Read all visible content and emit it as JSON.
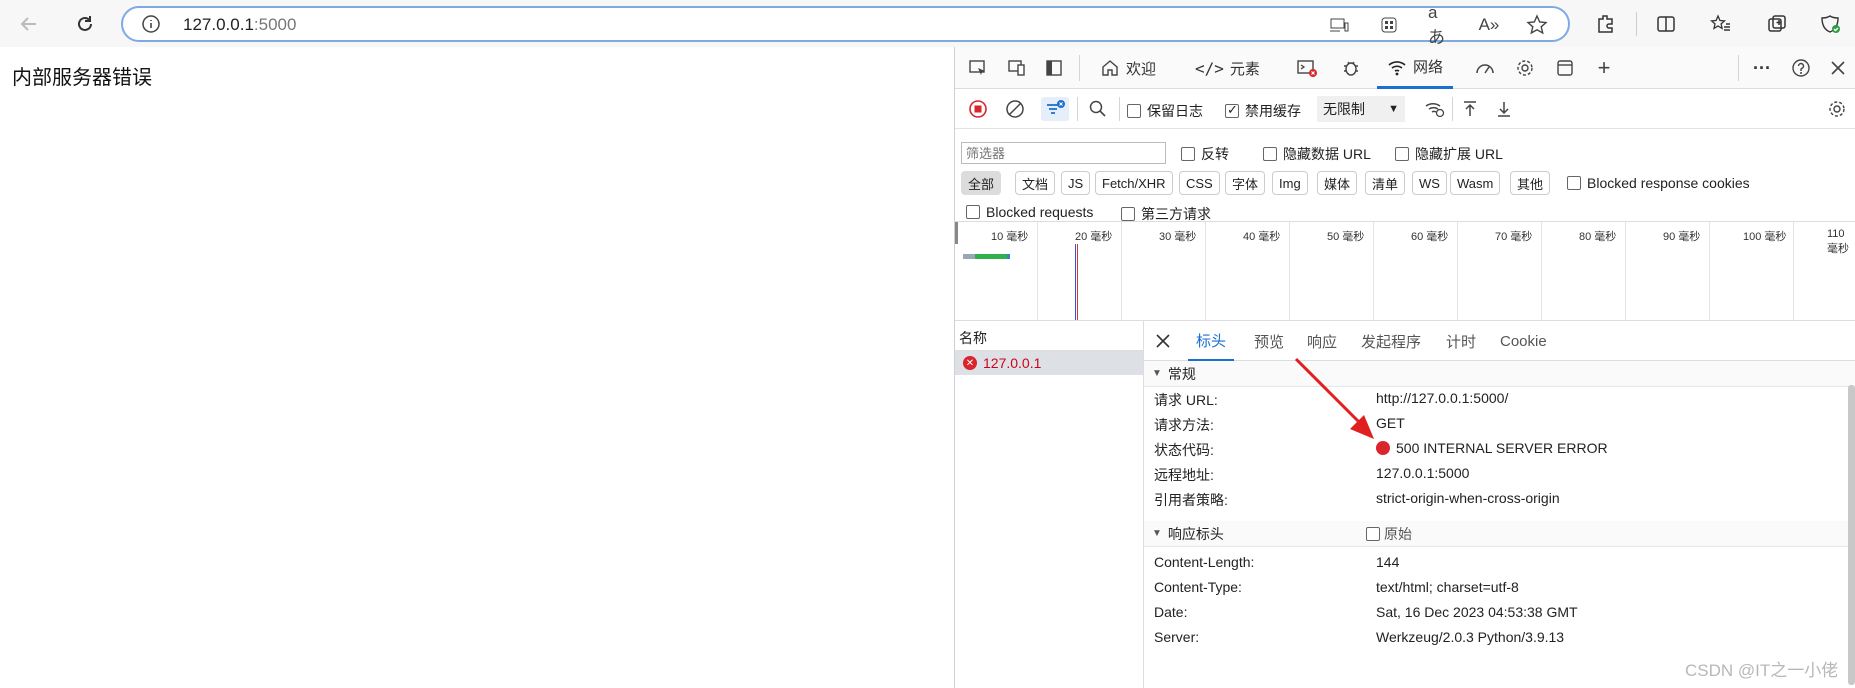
{
  "browser": {
    "url_host": "127.0.0.1",
    "url_port": ":5000"
  },
  "page": {
    "content_text": "内部服务器错误"
  },
  "devtools": {
    "tabs": [
      {
        "label": "欢迎",
        "icon": "home-icon"
      },
      {
        "label": "元素",
        "icon": "code-icon"
      },
      {
        "label": "网络",
        "icon": "wifi-icon",
        "active": true
      }
    ],
    "toolbar": {
      "preserve_log": "保留日志",
      "disable_cache": "禁用缓存",
      "throttle": "无限制"
    },
    "filter": {
      "placeholder": "筛选器",
      "invert": "反转",
      "hide_data_url": "隐藏数据 URL",
      "hide_ext_url": "隐藏扩展 URL",
      "types": [
        "全部",
        "文档",
        "JS",
        "Fetch/XHR",
        "CSS",
        "字体",
        "Img",
        "媒体",
        "清单",
        "WS",
        "Wasm",
        "其他"
      ],
      "blocked_cookies": "Blocked response cookies",
      "blocked_requests": "Blocked requests",
      "third_party": "第三方请求"
    },
    "timeline_ticks": [
      "10 毫秒",
      "20 毫秒",
      "30 毫秒",
      "40 毫秒",
      "50 毫秒",
      "60 毫秒",
      "70 毫秒",
      "80 毫秒",
      "90 毫秒",
      "100 毫秒",
      "110 毫秒"
    ],
    "name_col": {
      "header": "名称",
      "request": "127.0.0.1"
    },
    "detail_tabs": [
      "标头",
      "预览",
      "响应",
      "发起程序",
      "计时",
      "Cookie"
    ],
    "general": {
      "title": "常规",
      "rows": [
        {
          "k": "请求 URL:",
          "v": "http://127.0.0.1:5000/"
        },
        {
          "k": "请求方法:",
          "v": "GET"
        },
        {
          "k": "状态代码:",
          "v": "500 INTERNAL SERVER ERROR"
        },
        {
          "k": "远程地址:",
          "v": "127.0.0.1:5000"
        },
        {
          "k": "引用者策略:",
          "v": "strict-origin-when-cross-origin"
        }
      ]
    },
    "response_headers": {
      "title": "响应标头",
      "raw": "原始",
      "rows": [
        {
          "k": "Content-Length:",
          "v": "144"
        },
        {
          "k": "Content-Type:",
          "v": "text/html; charset=utf-8"
        },
        {
          "k": "Date:",
          "v": "Sat, 16 Dec 2023 04:53:38 GMT"
        },
        {
          "k": "Server:",
          "v": "Werkzeug/2.0.3 Python/3.9.13"
        }
      ]
    }
  },
  "watermark": "CSDN @IT之一小佬",
  "colors": {
    "accent": "#1a6fd0",
    "error": "#d9262c",
    "arrow": "#e02020"
  }
}
